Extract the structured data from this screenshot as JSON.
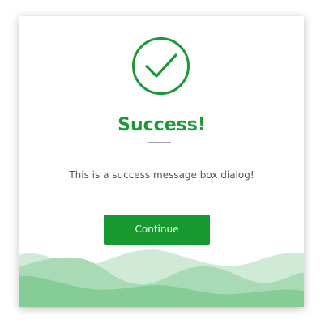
{
  "dialog": {
    "title": "Success!",
    "message": "This is a success message box dialog!",
    "button_label": "Continue"
  },
  "colors": {
    "accent": "#1a9a36",
    "button": "#17992f",
    "wave_light": "#cfead6",
    "wave_mid": "#a8dab5",
    "wave_dark": "#86cc97"
  },
  "icons": {
    "status": "check-circle-icon"
  }
}
